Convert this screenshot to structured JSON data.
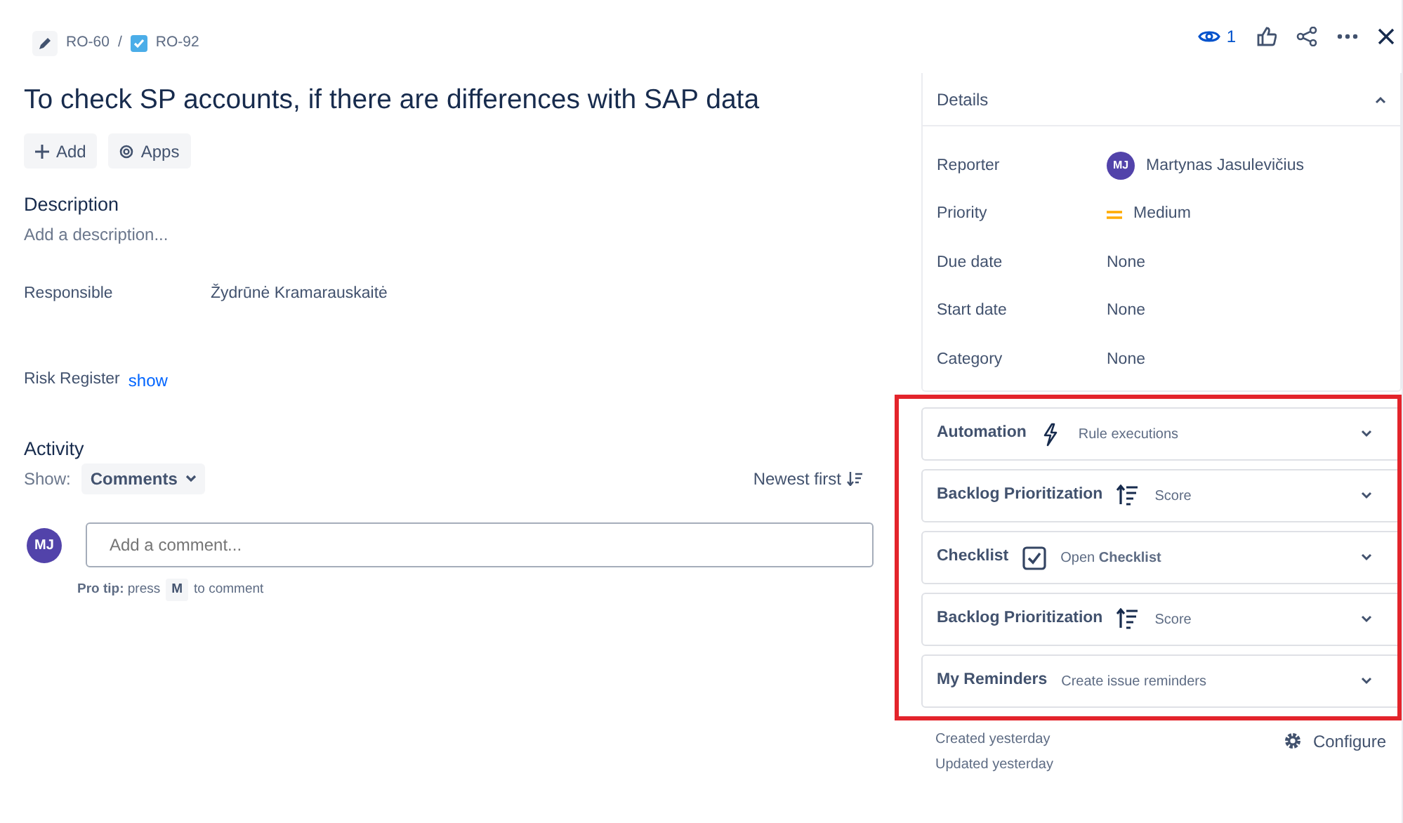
{
  "breadcrumbs": [
    {
      "kind": "edit",
      "label": "RO-60"
    },
    {
      "kind": "task",
      "label": "RO-92"
    }
  ],
  "breadcrumb_separator": "/",
  "toolbar": {
    "watchers": "1"
  },
  "title": "To check SP accounts, if there are differences with SAP data",
  "actions": [
    {
      "kind": "add",
      "label": "Add"
    },
    {
      "kind": "apps",
      "label": "Apps"
    }
  ],
  "description": {
    "heading": "Description",
    "placeholder": "Add a description..."
  },
  "fields": [
    {
      "kind": "value",
      "label": "Responsible",
      "value": "Žydrūnė Kramarauskaitė"
    },
    {
      "kind": "link",
      "label": "Risk Register",
      "value": "show"
    }
  ],
  "activity": {
    "heading": "Activity",
    "show_label": "Show:",
    "filter": "Comments",
    "sort": "Newest first",
    "avatar": "MJ",
    "comment_placeholder": "Add a comment...",
    "pro_tip": {
      "before": "**Pro tip:** press",
      "key": "M",
      "after": "to comment"
    }
  },
  "details": {
    "title": "Details",
    "expanded": true,
    "rows": [
      {
        "kind": "person",
        "label": "Reporter",
        "avatar": "MJ",
        "value": "Martynas Jasulevičius"
      },
      {
        "kind": "priority",
        "label": "Priority",
        "value": "Medium"
      },
      {
        "kind": "plain",
        "label": "Due date",
        "value": "None"
      },
      {
        "kind": "plain",
        "label": "Start date",
        "value": "None"
      },
      {
        "kind": "plain",
        "label": "Category",
        "value": "None"
      }
    ]
  },
  "panels": [
    {
      "title": "Automation",
      "kind": "bolt",
      "subtitle": "Rule executions",
      "expanded": false
    },
    {
      "title": "Backlog Prioritization",
      "kind": "sort",
      "subtitle": "Score",
      "expanded": false
    },
    {
      "title": "Checklist",
      "kind": "checkbox",
      "subtitle": "Open **Checklist**",
      "expanded": false
    },
    {
      "title": "Backlog Prioritization",
      "kind": "sort",
      "subtitle": "Score",
      "expanded": false
    },
    {
      "title": "My Reminders",
      "kind": "plain",
      "subtitle": "Create issue reminders",
      "expanded": false
    }
  ],
  "highlight": {
    "kind": "rectangle"
  },
  "meta": [
    "Created yesterday",
    "Updated yesterday"
  ],
  "configure": "Configure"
}
